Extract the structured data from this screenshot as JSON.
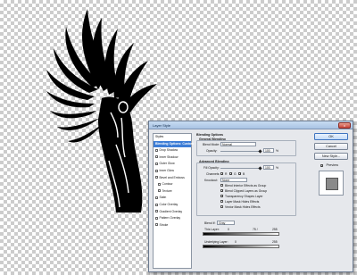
{
  "dialog": {
    "title": "Layer Style",
    "close_glyph": "x",
    "styles_header": "Styles",
    "style_items": [
      {
        "label": "Blending Options: Custom",
        "checked": false,
        "selected": true,
        "sub": false
      },
      {
        "label": "Drop Shadow",
        "checked": false,
        "selected": false,
        "sub": false
      },
      {
        "label": "Inner Shadow",
        "checked": false,
        "selected": false,
        "sub": false
      },
      {
        "label": "Outer Glow",
        "checked": false,
        "selected": false,
        "sub": false
      },
      {
        "label": "Inner Glow",
        "checked": false,
        "selected": false,
        "sub": false
      },
      {
        "label": "Bevel and Emboss",
        "checked": false,
        "selected": false,
        "sub": false
      },
      {
        "label": "Contour",
        "checked": false,
        "selected": false,
        "sub": true
      },
      {
        "label": "Texture",
        "checked": false,
        "selected": false,
        "sub": true
      },
      {
        "label": "Satin",
        "checked": false,
        "selected": false,
        "sub": false
      },
      {
        "label": "Color Overlay",
        "checked": false,
        "selected": false,
        "sub": false
      },
      {
        "label": "Gradient Overlay",
        "checked": false,
        "selected": false,
        "sub": false
      },
      {
        "label": "Pattern Overlay",
        "checked": false,
        "selected": false,
        "sub": false
      },
      {
        "label": "Stroke",
        "checked": false,
        "selected": false,
        "sub": false
      }
    ],
    "blending": {
      "section_title": "Blending Options",
      "general_title": "General Blending",
      "blend_mode_label": "Blend Mode:",
      "blend_mode_value": "Normal",
      "opacity_label": "Opacity:",
      "opacity_value": "100",
      "opacity_level": 1.0,
      "percent": "%"
    },
    "advanced": {
      "title": "Advanced Blending",
      "fill_opacity_label": "Fill Opacity:",
      "fill_opacity_value": "100",
      "fill_opacity_level": 1.0,
      "channels_label": "Channels:",
      "channel_r": "R",
      "channel_g": "G",
      "channel_b": "B",
      "knockout_label": "Knockout:",
      "knockout_value": "None",
      "options": [
        {
          "label": "Blend Interior Effects as Group",
          "checked": false
        },
        {
          "label": "Blend Clipped Layers as Group",
          "checked": true
        },
        {
          "label": "Transparency Shapes Layer",
          "checked": true
        },
        {
          "label": "Layer Mask Hides Effects",
          "checked": false
        },
        {
          "label": "Vector Mask Hides Effects",
          "checked": false
        }
      ]
    },
    "blend_if": {
      "label": "Blend If:",
      "value": "Gray",
      "this_layer_label": "This Layer:",
      "this_layer_low": "0",
      "this_layer_mid": "75 /",
      "this_layer_high": "255",
      "underlying_label": "Underlying Layer:",
      "underlying_low": "0",
      "underlying_high": "255"
    },
    "buttons": {
      "ok": "OK",
      "cancel": "Cancel",
      "new_style": "New Style...",
      "preview_label": "Preview",
      "preview_checked": true
    }
  }
}
